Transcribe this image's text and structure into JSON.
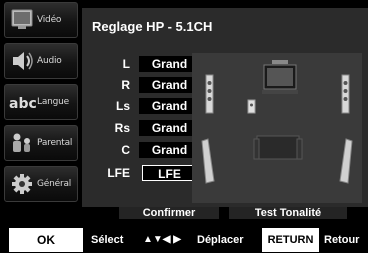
{
  "sidebar": {
    "items": [
      {
        "label": "Vidéo",
        "icon": "tv-icon"
      },
      {
        "label": "Audio",
        "icon": "speaker-icon"
      },
      {
        "label": "Langue",
        "icon": "language-abc-icon"
      },
      {
        "label": "Parental",
        "icon": "family-icon"
      },
      {
        "label": "Général",
        "icon": "gear-icon"
      }
    ]
  },
  "panel": {
    "title": "Reglage HP - 5.1CH",
    "channels": [
      {
        "channel": "L",
        "value": "Grand"
      },
      {
        "channel": "R",
        "value": "Grand"
      },
      {
        "channel": "Ls",
        "value": "Grand"
      },
      {
        "channel": "Rs",
        "value": "Grand"
      },
      {
        "channel": "C",
        "value": "Grand"
      },
      {
        "channel": "LFE",
        "value": "LFE"
      }
    ],
    "selected_channel": "LFE"
  },
  "buttons": {
    "confirm": "Confirmer",
    "test_tone": "Test Tonalité"
  },
  "footer": {
    "ok_key": "OK",
    "ok_text": "Sélect",
    "arrows": "▲▼◀ ▶",
    "arrows_text": "Déplacer",
    "return_key": "RETURN",
    "return_text": "Retour"
  },
  "colors": {
    "background": "#000000",
    "panel": "#2b2b2b",
    "scene": "#3a3a3a",
    "value_box": "#000000",
    "key_box": "#ffffff"
  }
}
